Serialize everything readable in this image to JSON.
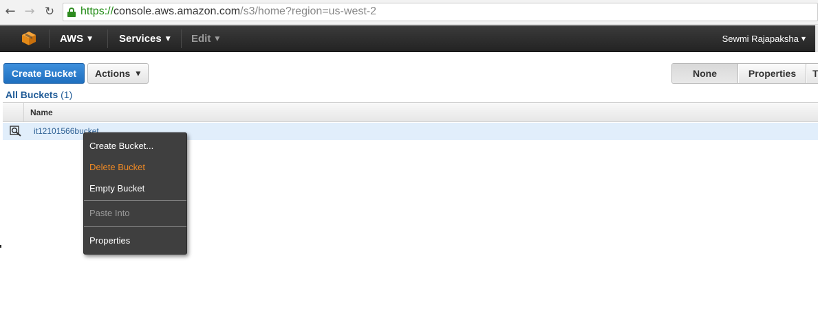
{
  "browser": {
    "url_scheme": "https://",
    "url_host": "console.aws.amazon.com",
    "url_path": "/s3/home?region=us-west-2"
  },
  "topnav": {
    "aws_label": "AWS",
    "services_label": "Services",
    "edit_label": "Edit",
    "user_label": "Sewmi Rajapaksha"
  },
  "toolbar": {
    "create_bucket_label": "Create Bucket",
    "actions_label": "Actions",
    "view_none_label": "None",
    "view_properties_label": "Properties",
    "view_more_label": "T"
  },
  "breadcrumb": {
    "label": "All Buckets",
    "count": "(1)"
  },
  "table": {
    "name_header": "Name",
    "rows": [
      {
        "name": "it12101566bucket"
      }
    ]
  },
  "context_menu": {
    "items": [
      {
        "label": "Create Bucket...",
        "state": "normal"
      },
      {
        "label": "Delete Bucket",
        "state": "highlighted"
      },
      {
        "label": "Empty Bucket",
        "state": "normal"
      },
      {
        "label": "Paste Into",
        "state": "disabled"
      },
      {
        "label": "Properties",
        "state": "normal"
      }
    ]
  },
  "colors": {
    "primary_button": "#1f6fbf",
    "nav_background": "#232323",
    "menu_highlight": "#f08a24",
    "link": "#1e5a96",
    "selected_row": "#e1eefb"
  },
  "icons": {
    "back": "back-arrow-icon",
    "forward": "forward-arrow-icon",
    "reload": "reload-icon",
    "lock": "lock-icon",
    "logo": "aws-cube-icon",
    "bucket_row": "magnifier-icon"
  }
}
